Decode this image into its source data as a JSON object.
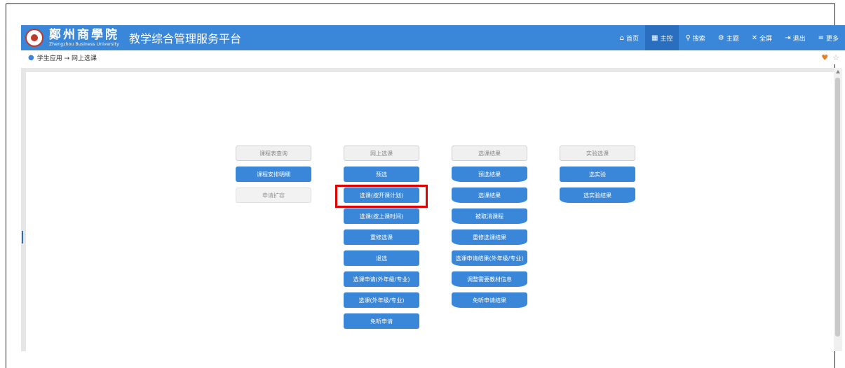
{
  "header": {
    "logo_cn": "鄭州商學院",
    "logo_en": "Zhengzhou Business University",
    "platform_title": "教学综合管理服务平台",
    "nav": [
      {
        "icon": "home-icon",
        "glyph": "⌂",
        "label": "首页"
      },
      {
        "icon": "dashboard-icon",
        "glyph": "▦",
        "label": "主控"
      },
      {
        "icon": "search-icon",
        "glyph": "⚲",
        "label": "搜索"
      },
      {
        "icon": "gears-icon",
        "glyph": "⚙",
        "label": "主题"
      },
      {
        "icon": "fullscreen-icon",
        "glyph": "✕",
        "label": "全屏"
      },
      {
        "icon": "logout-icon",
        "glyph": "⇥",
        "label": "退出"
      },
      {
        "icon": "menu-icon",
        "glyph": "≡",
        "label": "更多"
      }
    ]
  },
  "breadcrumb": {
    "text": "学生应用 → 网上选课",
    "heart": "♥",
    "star": "☆"
  },
  "columns": [
    {
      "name": "course-query-column",
      "buttons": [
        {
          "label": "课程表查询",
          "style": "head"
        },
        {
          "label": "课程安排明细",
          "style": "blue"
        },
        {
          "label": "申请扩容",
          "style": "gray"
        }
      ]
    },
    {
      "name": "online-selection-column",
      "buttons": [
        {
          "label": "网上选课",
          "style": "head"
        },
        {
          "label": "预选",
          "style": "blue"
        },
        {
          "label": "选课(按开课计划)",
          "style": "blue"
        },
        {
          "label": "选课(按上课时间)",
          "style": "blue"
        },
        {
          "label": "重修选课",
          "style": "blue"
        },
        {
          "label": "退选",
          "style": "blue"
        },
        {
          "label": "选课申请(外年级/专业)",
          "style": "blue"
        },
        {
          "label": "选课(外年级/专业)",
          "style": "blue"
        },
        {
          "label": "免听申请",
          "style": "blue"
        }
      ]
    },
    {
      "name": "selection-result-column",
      "buttons": [
        {
          "label": "选课结果",
          "style": "head"
        },
        {
          "label": "预选结果",
          "style": "blue curve"
        },
        {
          "label": "选课结果",
          "style": "blue curve"
        },
        {
          "label": "被取消课程",
          "style": "blue curve"
        },
        {
          "label": "重修选课结果",
          "style": "blue curve"
        },
        {
          "label": "选课申请结果(外年级/专业)",
          "style": "blue curve"
        },
        {
          "label": "调整需要教材信息",
          "style": "blue curve"
        },
        {
          "label": "免听申请结果",
          "style": "blue curve"
        }
      ]
    },
    {
      "name": "lab-selection-column",
      "buttons": [
        {
          "label": "实验选课",
          "style": "head"
        },
        {
          "label": "选实验",
          "style": "blue"
        },
        {
          "label": "选实验结果",
          "style": "blue curve"
        }
      ]
    }
  ]
}
